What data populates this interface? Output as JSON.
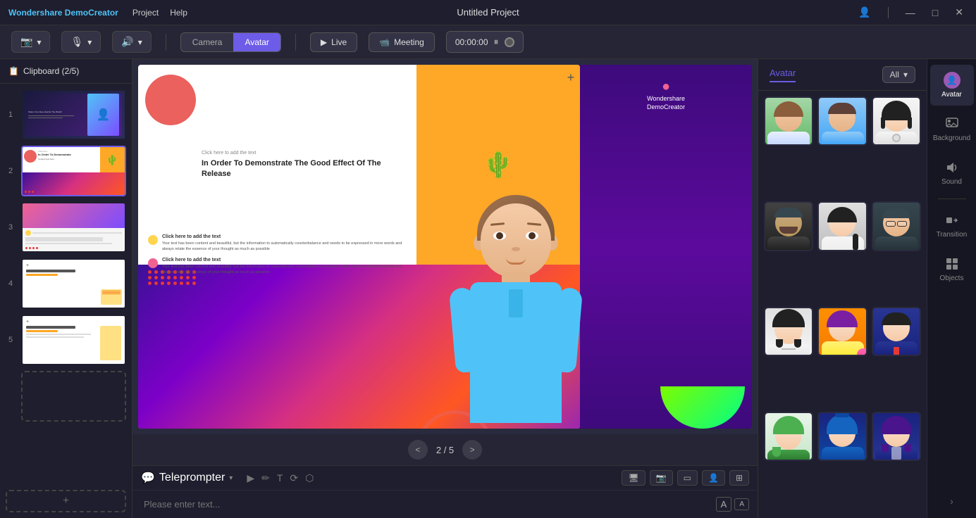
{
  "titlebar": {
    "brand": "Wondershare DemoCreator",
    "menus": [
      "Project",
      "Help"
    ],
    "title": "Untitled Project",
    "controls": [
      "—",
      "□",
      "✕"
    ]
  },
  "toolbar": {
    "camera_label": "Camera",
    "avatar_label": "Avatar",
    "live_label": "Live",
    "meeting_label": "Meeting",
    "timer": "00:00:00"
  },
  "clipboard": {
    "header": "Clipboard (2/5)",
    "slides": [
      {
        "num": "1",
        "active": false
      },
      {
        "num": "2",
        "active": true
      },
      {
        "num": "3",
        "active": false
      },
      {
        "num": "4",
        "active": false
      },
      {
        "num": "5",
        "active": false
      }
    ]
  },
  "preview": {
    "nav_current": "2",
    "nav_total": "5",
    "nav_prev": "<",
    "nav_next": ">"
  },
  "teleprompter": {
    "label": "Teleprompter",
    "placeholder": "Please enter text...",
    "font_increase": "A",
    "font_decrease": "A"
  },
  "avatar_panel": {
    "tab_label": "Avatar",
    "filter_label": "All",
    "avatars": [
      {
        "id": 1,
        "bg": "green",
        "gender": "female"
      },
      {
        "id": 2,
        "bg": "blue",
        "gender": "male"
      },
      {
        "id": 3,
        "bg": "light",
        "gender": "female"
      },
      {
        "id": 4,
        "bg": "dark",
        "gender": "male"
      },
      {
        "id": 5,
        "bg": "gray",
        "gender": "female"
      },
      {
        "id": 6,
        "bg": "darkblue",
        "gender": "male"
      },
      {
        "id": 7,
        "bg": "lightgray",
        "gender": "female"
      },
      {
        "id": 8,
        "bg": "orange",
        "gender": "female"
      },
      {
        "id": 9,
        "bg": "navy",
        "gender": "male"
      },
      {
        "id": 10,
        "bg": "lightgreen",
        "gender": "female"
      },
      {
        "id": 11,
        "bg": "blue2",
        "gender": "female"
      },
      {
        "id": 12,
        "bg": "darkblue2",
        "gender": "female"
      }
    ]
  },
  "side_panel": {
    "items": [
      {
        "id": "avatar",
        "label": "Avatar",
        "icon": "👤",
        "active": true
      },
      {
        "id": "background",
        "label": "Background",
        "icon": "🖼",
        "active": false
      },
      {
        "id": "sound",
        "label": "Sound",
        "icon": "🔊",
        "active": false
      },
      {
        "id": "transition",
        "label": "Transition",
        "icon": "⏭",
        "active": false
      },
      {
        "id": "objects",
        "label": "Objects",
        "icon": "⊞",
        "active": false
      }
    ]
  },
  "slide_content": {
    "click_text": "Click here to add the text",
    "heading": "In Order To Demonstrate The Good Effect Of The Release",
    "row1_label": "Click here to add the text",
    "row1_text": "Your text has been content and beautiful, but the information to automatically counterbalance and needs to be expressed in more words and always relate the essence of your thought as much as possible",
    "row2_label": "Click here to add the text",
    "row2_text": "Your text has been content and beautiful, but the information to automatically counterbalance and needs to be expressed in more words and always relate the essence of your thought as much as possible"
  }
}
